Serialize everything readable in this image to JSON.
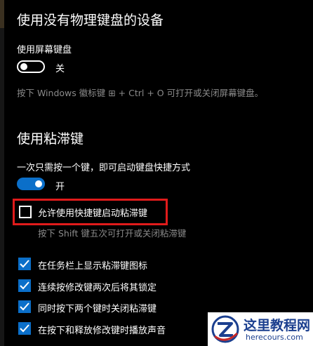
{
  "section1": {
    "title": "使用没有物理键盘的设备",
    "onscreen_keyboard_label": "使用屏幕键盘",
    "onscreen_keyboard_state": "关",
    "hint": "按下 Windows 徽标键 ⊞ + Ctrl + O 可打开或关闭屏幕键盘。"
  },
  "section2": {
    "title": "使用粘滞键",
    "description": "一次只需按一个键，即可启动键盘快捷方式",
    "toggle_state": "开",
    "shortcut_checkbox_label": "允许使用快捷键启动粘滞键",
    "shortcut_hint": "按下 Shift 键五次可打开或关闭粘滞键",
    "options": [
      {
        "label": "在任务栏上显示粘滞键图标",
        "checked": true
      },
      {
        "label": "连续按修改键两次后将其锁定",
        "checked": true
      },
      {
        "label": "同时按下两个键时关闭粘滞键",
        "checked": true
      },
      {
        "label": "在按下和释放修改键时播放声音",
        "checked": true
      }
    ]
  },
  "watermark": {
    "name": "这里教程网",
    "url": "herecours.com"
  },
  "colors": {
    "accent": "#0b6fc9",
    "highlight": "#e01b1b",
    "background": "#000000"
  }
}
